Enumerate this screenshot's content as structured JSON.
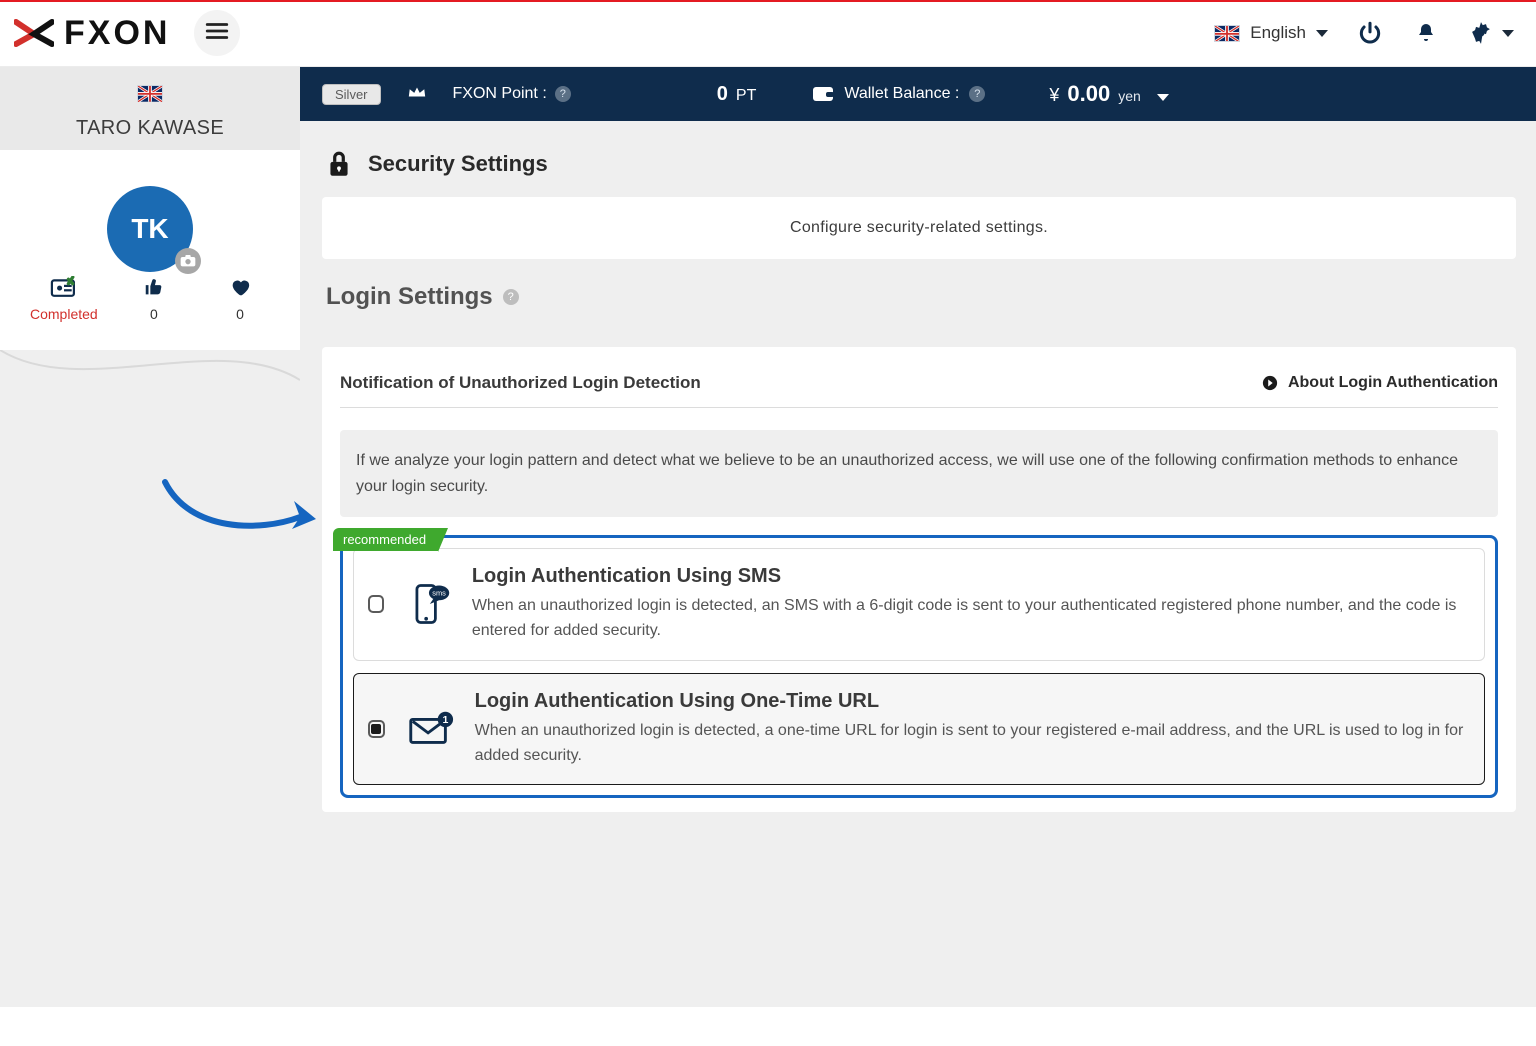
{
  "header": {
    "language_label": "English"
  },
  "sidebar": {
    "flag": "uk",
    "user_name": "TARO KAWASE",
    "avatar_initials": "TK",
    "stats": {
      "completed_label": "Completed",
      "likes": "0",
      "hearts": "0"
    }
  },
  "infobar": {
    "tier": "Silver",
    "points_label": "FXON Point :",
    "points_value": "0",
    "points_unit": "PT",
    "wallet_label": "Wallet Balance :",
    "currency_symbol": "¥",
    "balance_value": "0.00",
    "currency_unit": "yen"
  },
  "page": {
    "title": "Security Settings",
    "subtitle": "Configure security-related settings.",
    "section_login_title": "Login Settings",
    "row_head": "Notification of Unauthorized Login Detection",
    "about_label": "About Login Authentication",
    "note": "If we analyze your login pattern and detect what we believe to be an unauthorized access, we will use one of the following confirmation methods to enhance your login security.",
    "reco_badge": "recommended",
    "options": [
      {
        "key": "sms",
        "title": "Login Authentication Using SMS",
        "desc": "When an unauthorized login is detected, an SMS with a 6-digit code is sent to your authenticated registered phone number, and the code is entered for added security.",
        "selected": false
      },
      {
        "key": "url",
        "title": "Login Authentication Using One-Time URL",
        "desc": "When an unauthorized login is detected, a one-time URL for login is sent to your registered e-mail address, and the URL is used to log in for added security.",
        "selected": true
      }
    ]
  }
}
